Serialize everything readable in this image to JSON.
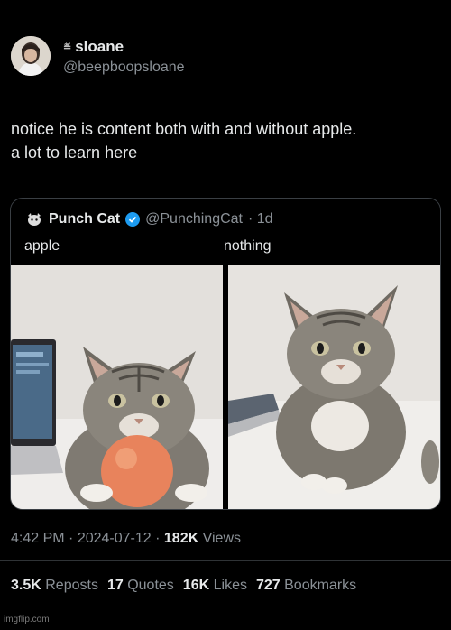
{
  "author": {
    "name": "sloane",
    "handle": "@beepboopsloane"
  },
  "tweet": {
    "text_line1": "notice he is content both with and without apple.",
    "text_line2": "a lot to learn here"
  },
  "quoted": {
    "name": "Punch Cat",
    "handle": "@PunchingCat",
    "age": "· 1d",
    "left_label": "apple",
    "right_label": "nothing"
  },
  "meta": {
    "time": "4:42 PM",
    "separator": "·",
    "date": "2024-07-12",
    "views_count": "182K",
    "views_label": "Views"
  },
  "stats": [
    {
      "count": "3.5K",
      "label": "Reposts"
    },
    {
      "count": "17",
      "label": "Quotes"
    },
    {
      "count": "16K",
      "label": "Likes"
    },
    {
      "count": "727",
      "label": "Bookmarks"
    }
  ],
  "watermark": "imgflip.com",
  "colors": {
    "background": "#000000",
    "text": "#e7e9ea",
    "muted": "#8b9197",
    "verified": "#1d9bf0",
    "border": "#3a3f44"
  }
}
